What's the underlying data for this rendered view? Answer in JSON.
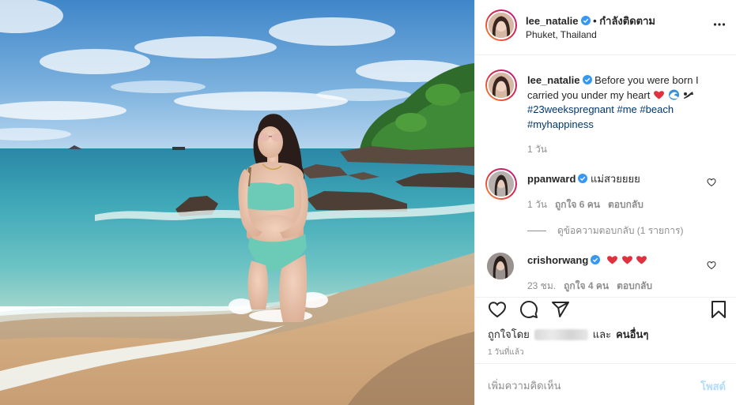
{
  "post": {
    "author": "lee_natalie",
    "follow_status": "• กำลังติดตาม",
    "location": "Phuket, Thailand",
    "caption": {
      "username": "lee_natalie",
      "text": "Before you were born I carried you under my heart",
      "emojis": [
        "red-heart",
        "wave",
        "mermaid-tail"
      ],
      "hashtags": [
        "#23weekspregnant",
        "#me",
        "#beach",
        "#myhappiness"
      ],
      "time": "1 วัน"
    },
    "comments": [
      {
        "username": "ppanward",
        "text": "แม่สวยยยย",
        "time": "1 วัน",
        "likes": "ถูกใจ 6 คน",
        "reply": "ตอบกลับ",
        "view_replies": "ดูข้อความตอบกลับ (1 รายการ)"
      },
      {
        "username": "crishorwang",
        "text": "",
        "emojis": [
          "red-heart",
          "red-heart",
          "red-heart"
        ],
        "time": "23 ชม.",
        "likes": "ถูกใจ 4 คน",
        "reply": "ตอบกลับ"
      }
    ],
    "liked_by_prefix": "ถูกใจโดย",
    "liked_by_suffix": "และ",
    "liked_by_others": "คนอื่นๆ",
    "posted_ago": "1 วันที่แล้ว",
    "add_comment_placeholder": "เพิ่มความคิดเห็น",
    "post_button": "โพสต์"
  },
  "icons": {
    "more": "more-horizontal-icon",
    "verified": "verified-badge-icon",
    "like": "heart-icon",
    "comment": "comment-bubble-icon",
    "share": "paper-plane-icon",
    "save": "bookmark-icon"
  },
  "colors": {
    "verified": "#3897f0",
    "link": "#00376b",
    "muted": "#8e8e8e",
    "post_button_disabled": "#b3dbff",
    "heart": "#ed4956"
  }
}
